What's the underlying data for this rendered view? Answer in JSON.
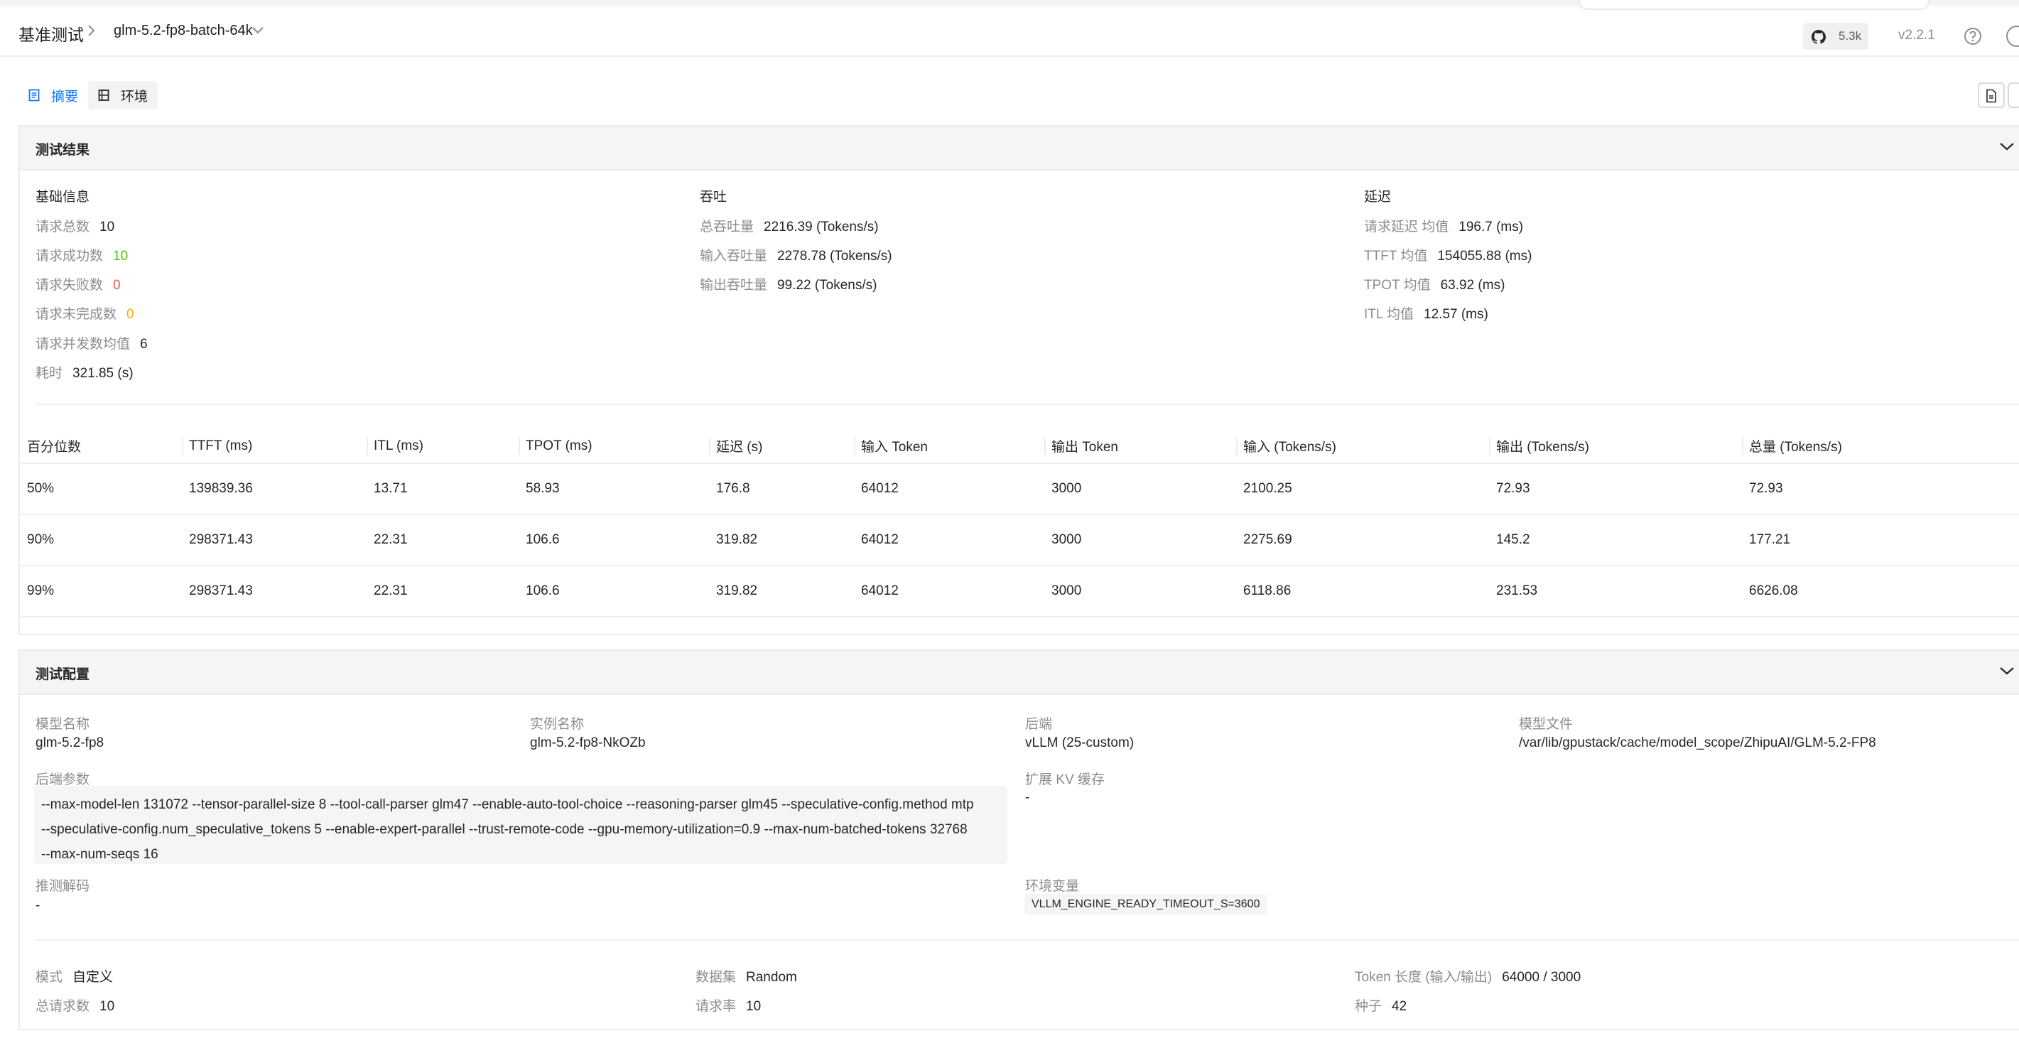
{
  "header": {
    "breadcrumb_root": "基准测试",
    "breadcrumb_separator": ">",
    "breadcrumb_current": "glm-5.2-fp8-batch-64k",
    "github_stars": "5.3k",
    "version": "v2.2.1"
  },
  "tabs": [
    {
      "label": "摘要",
      "icon": "document-icon",
      "active": true
    },
    {
      "label": "环境",
      "icon": "server-icon",
      "active": false
    }
  ],
  "results": {
    "title": "测试结果",
    "basic": {
      "title": "基础信息",
      "rows": [
        {
          "label": "请求总数",
          "value": "10"
        },
        {
          "label": "请求成功数",
          "value": "10"
        },
        {
          "label": "请求失败数",
          "value": "0"
        },
        {
          "label": "请求未完成数",
          "value": "0"
        },
        {
          "label": "请求并发数均值",
          "value": "6"
        },
        {
          "label": "耗时",
          "value": "321.85 (s)"
        }
      ]
    },
    "throughput": {
      "title": "吞吐",
      "rows": [
        {
          "label": "总吞吐量",
          "value": "2216.39 (Tokens/s)"
        },
        {
          "label": "输入吞吐量",
          "value": "2278.78 (Tokens/s)"
        },
        {
          "label": "输出吞吐量",
          "value": "99.22 (Tokens/s)"
        }
      ]
    },
    "latency": {
      "title": "延迟",
      "rows": [
        {
          "label": "请求延迟 均值",
          "value": "196.7 (ms)"
        },
        {
          "label": "TTFT 均值",
          "value": "154055.88 (ms)"
        },
        {
          "label": "TPOT 均值",
          "value": "63.92 (ms)"
        },
        {
          "label": "ITL 均值",
          "value": "12.57 (ms)"
        }
      ]
    },
    "percentile_table": {
      "columns": [
        "百分位数",
        "TTFT (ms)",
        "ITL (ms)",
        "TPOT (ms)",
        "延迟 (s)",
        "输入 Token",
        "输出 Token",
        "输入 (Tokens/s)",
        "输出 (Tokens/s)",
        "总量 (Tokens/s)"
      ],
      "rows": [
        [
          "50%",
          "139839.36",
          "13.71",
          "58.93",
          "176.8",
          "64012",
          "3000",
          "2100.25",
          "72.93",
          "72.93"
        ],
        [
          "90%",
          "298371.43",
          "22.31",
          "106.6",
          "319.82",
          "64012",
          "3000",
          "2275.69",
          "145.2",
          "177.21"
        ],
        [
          "99%",
          "298371.43",
          "22.31",
          "106.6",
          "319.82",
          "64012",
          "3000",
          "6118.86",
          "231.53",
          "6626.08"
        ]
      ]
    }
  },
  "config": {
    "title": "测试配置",
    "model_name_label": "模型名称",
    "model_name": "glm-5.2-fp8",
    "instance_name_label": "实例名称",
    "instance_name": "glm-5.2-fp8-NkOZb",
    "backend_label": "后端",
    "backend": "vLLM (25-custom)",
    "model_file_label": "模型文件",
    "model_file": "/var/lib/gpustack/cache/model_scope/ZhipuAI/GLM-5.2-FP8",
    "backend_args_label": "后端参数",
    "backend_args_lines": [
      "--max-model-len 131072  --tensor-parallel-size 8  --tool-call-parser glm47  --enable-auto-tool-choice  --reasoning-parser glm45  --speculative-config.method mtp",
      "--speculative-config.num_speculative_tokens 5  --enable-expert-parallel  --trust-remote-code  --gpu-memory-utilization=0.9  --max-num-batched-tokens 32768",
      "--max-num-seqs 16"
    ],
    "kv_cache_label": "扩展 KV 缓存",
    "kv_cache": "-",
    "spec_decode_label": "推测解码",
    "spec_decode": "-",
    "env_label": "环境变量",
    "env": "VLLM_ENGINE_READY_TIMEOUT_S=3600",
    "mode_label": "模式",
    "mode": "自定义",
    "dataset_label": "数据集",
    "dataset": "Random",
    "token_len_label": "Token 长度 (输入/输出)",
    "token_len": "64000 / 3000",
    "total_requests_label": "总请求数",
    "total_requests": "10",
    "request_rate_label": "请求率",
    "request_rate": "10",
    "seed_label": "种子",
    "seed": "42"
  },
  "colors": {
    "accent": "#1677ff",
    "success": "#52c41a",
    "error": "#ff4d4f",
    "warning": "#faad14"
  }
}
